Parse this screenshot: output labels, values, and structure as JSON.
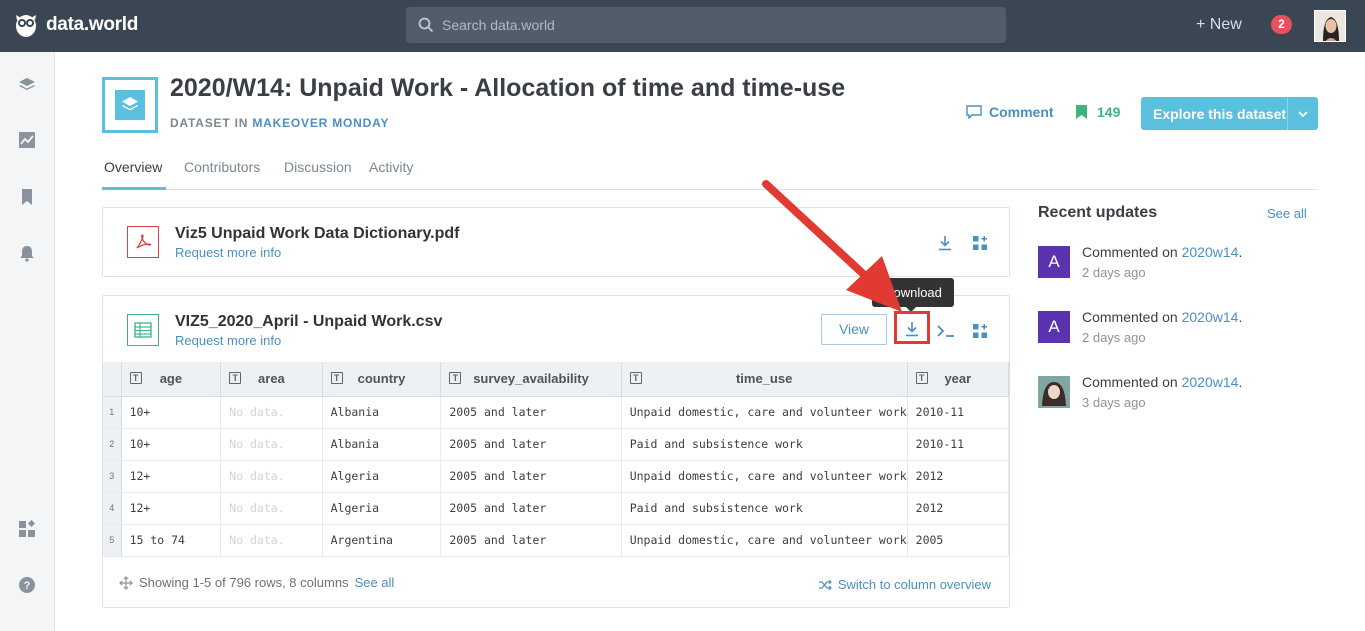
{
  "topbar": {
    "brand": "data.world",
    "search_placeholder": "Search data.world",
    "new_label": "+ New",
    "notification_count": "2"
  },
  "dataset": {
    "title": "2020/W14: Unpaid Work - Allocation of time and time-use",
    "subtitle_prefix": "DATASET IN ",
    "org": "MAKEOVER MONDAY",
    "comment_label": "Comment",
    "bookmark_count": "149",
    "explore_label": "Explore this dataset"
  },
  "tabs": [
    {
      "label": "Overview",
      "active": true
    },
    {
      "label": "Contributors"
    },
    {
      "label": "Discussion"
    },
    {
      "label": "Activity"
    }
  ],
  "files": [
    {
      "name": "Viz5 Unpaid Work Data Dictionary.pdf",
      "request": "Request more info"
    },
    {
      "name": "VIZ5_2020_April - Unpaid Work.csv",
      "request": "Request more info",
      "view_label": "View"
    }
  ],
  "tooltip": "Download",
  "table": {
    "columns": [
      "age",
      "area",
      "country",
      "survey_availability",
      "time_use",
      "year"
    ],
    "rows": [
      {
        "n": "1",
        "age": "10+",
        "area": "No data.",
        "country": "Albania",
        "survey": "2005 and later",
        "time_use": "Unpaid domestic, care and volunteer work",
        "year": "2010-11"
      },
      {
        "n": "2",
        "age": "10+",
        "area": "No data.",
        "country": "Albania",
        "survey": "2005 and later",
        "time_use": "Paid and subsistence work",
        "year": "2010-11"
      },
      {
        "n": "3",
        "age": "12+",
        "area": "No data.",
        "country": "Algeria",
        "survey": "2005 and later",
        "time_use": "Unpaid domestic, care and volunteer work",
        "year": "2012"
      },
      {
        "n": "4",
        "age": "12+",
        "area": "No data.",
        "country": "Algeria",
        "survey": "2005 and later",
        "time_use": "Paid and subsistence work",
        "year": "2012"
      },
      {
        "n": "5",
        "age": "15 to 74",
        "area": "No data.",
        "country": "Argentina",
        "survey": "2005 and later",
        "time_use": "Unpaid domestic, care and volunteer work",
        "year": "2005"
      }
    ],
    "showing": "Showing 1-5 of 796 rows, 8 columns",
    "see_all": "See all",
    "switch_label": "Switch to column overview"
  },
  "recent": {
    "title": "Recent updates",
    "see_all": "See all",
    "items": [
      {
        "avatar": "A",
        "action": "Commented on ",
        "target": "2020w14",
        "suffix": ".",
        "time": "2 days ago"
      },
      {
        "avatar": "A",
        "action": "Commented on ",
        "target": "2020w14",
        "suffix": ".",
        "time": "2 days ago"
      },
      {
        "avatar": "",
        "action": "Commented on ",
        "target": "2020w14",
        "suffix": ".",
        "time": "3 days ago"
      }
    ]
  },
  "colors": {
    "topbar": "#3a4654",
    "accent": "#5bc0de",
    "link": "#4a90c2",
    "bookmark": "#3fb37f",
    "arrow": "#e03a33",
    "avatar_purple": "#5a33b0"
  }
}
